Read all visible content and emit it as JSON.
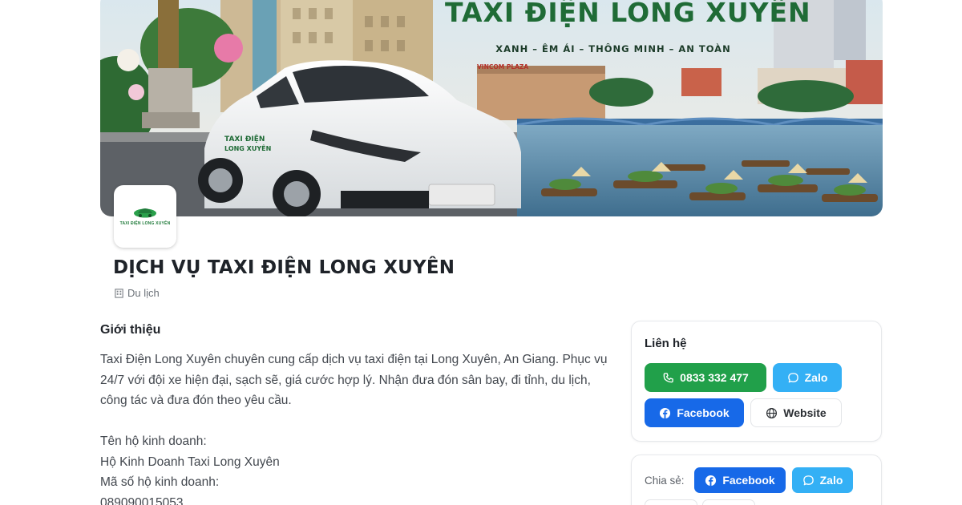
{
  "cover": {
    "headline": "TAXI ĐIỆN LONG XUYÊN",
    "tagline": "XANH – ÊM ÁI – THÔNG MINH – AN TOÀN",
    "plaza_sign": "VINCOM PLAZA",
    "car_door_text": "TAXI ĐIỆN LONG XUYÊN"
  },
  "logo": {
    "text": "TAXI ĐIỆN LONG XUYÊN"
  },
  "business": {
    "title": "DỊCH VỤ TAXI ĐIỆN LONG XUYÊN",
    "category": "Du lịch"
  },
  "intro": {
    "heading": "Giới thiệu",
    "description": "Taxi Điện Long Xuyên chuyên cung cấp dịch vụ taxi điện tại Long Xuyên, An Giang. Phục vụ 24/7 với đội xe hiện đại, sạch sẽ, giá cước hợp lý. Nhận đưa đón sân bay, đi tỉnh, du lịch, công tác và đưa đón theo yêu cầu.",
    "owner_label": "Tên hộ kinh doanh:",
    "owner_value": "Hộ Kinh Doanh Taxi Long Xuyên",
    "tax_label": "Mã số hộ kinh doanh:",
    "tax_value": "089090015053"
  },
  "contact": {
    "heading": "Liên hệ",
    "phone": "0833 332 477",
    "zalo": "Zalo",
    "facebook": "Facebook",
    "website": "Website"
  },
  "share": {
    "label": "Chia sẻ:",
    "facebook": "Facebook",
    "zalo": "Zalo"
  },
  "colors": {
    "phone_green": "#21a04a",
    "zalo_blue": "#34b0f5",
    "facebook_blue": "#1769e8",
    "headline_green": "#1f6b36"
  },
  "icons": [
    "phone-icon",
    "chat-bubble-icon",
    "facebook-icon",
    "globe-icon",
    "building-icon"
  ]
}
